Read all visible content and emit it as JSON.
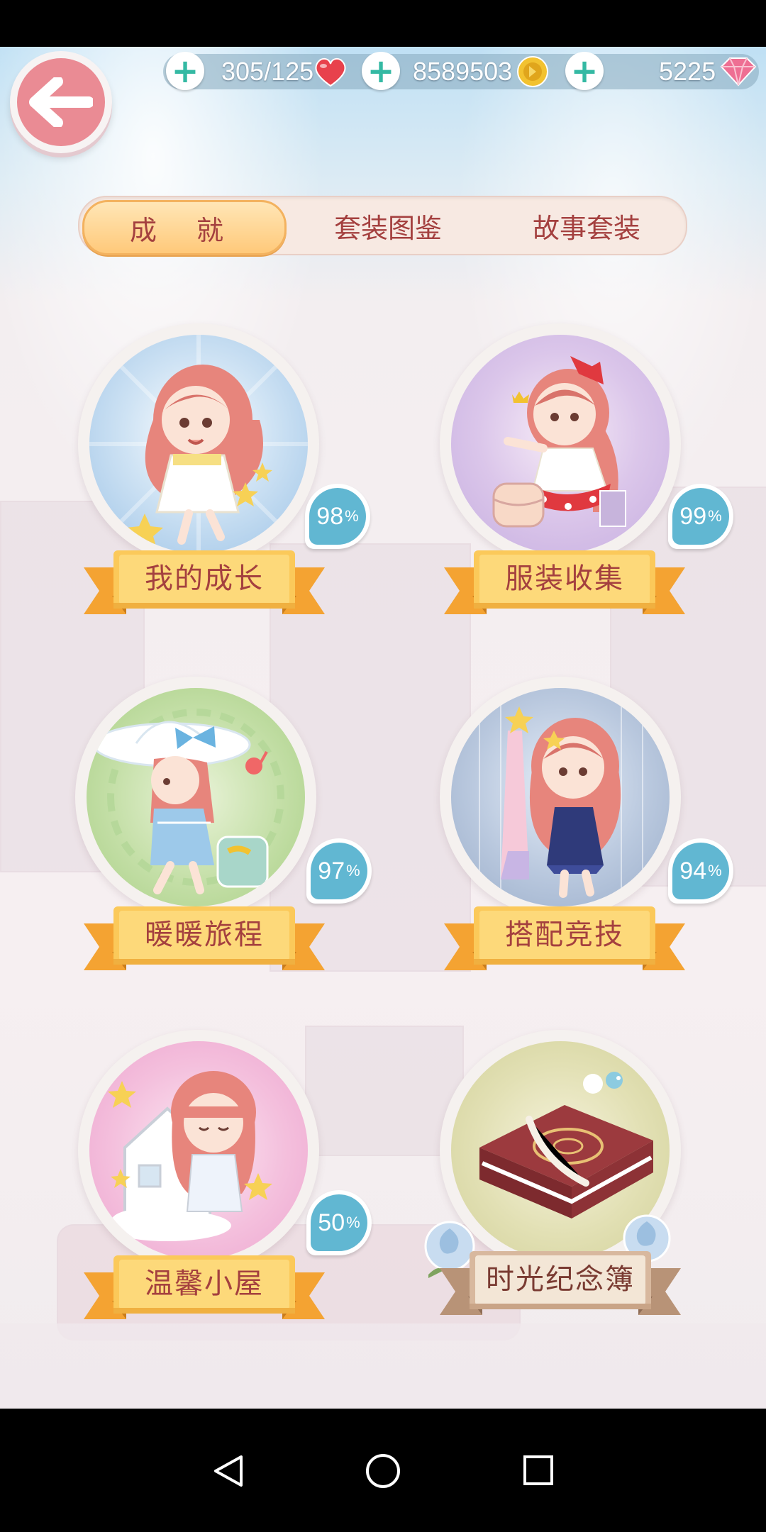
{
  "resources": {
    "stamina": "305/125",
    "gold": "8589503",
    "diamonds": "5225"
  },
  "tabs": [
    {
      "label": "成 就",
      "active": true
    },
    {
      "label": "套装图鉴",
      "active": false
    },
    {
      "label": "故事套装",
      "active": false
    }
  ],
  "categories": [
    {
      "label": "我的成长",
      "percent": "98",
      "unit": "%"
    },
    {
      "label": "服装收集",
      "percent": "99",
      "unit": "%"
    },
    {
      "label": "暖暖旅程",
      "percent": "97",
      "unit": "%"
    },
    {
      "label": "搭配竞技",
      "percent": "94",
      "unit": "%"
    },
    {
      "label": "温馨小屋",
      "percent": "50",
      "unit": "%"
    },
    {
      "label": "时光纪念簿"
    }
  ],
  "colors": {
    "ribbon_gold": "#fbc95a",
    "ribbon_tan": "#d8b89e",
    "badge_blue": "#61b7d2",
    "label_red": "#a4403f",
    "back_pink": "#ea8b94"
  }
}
